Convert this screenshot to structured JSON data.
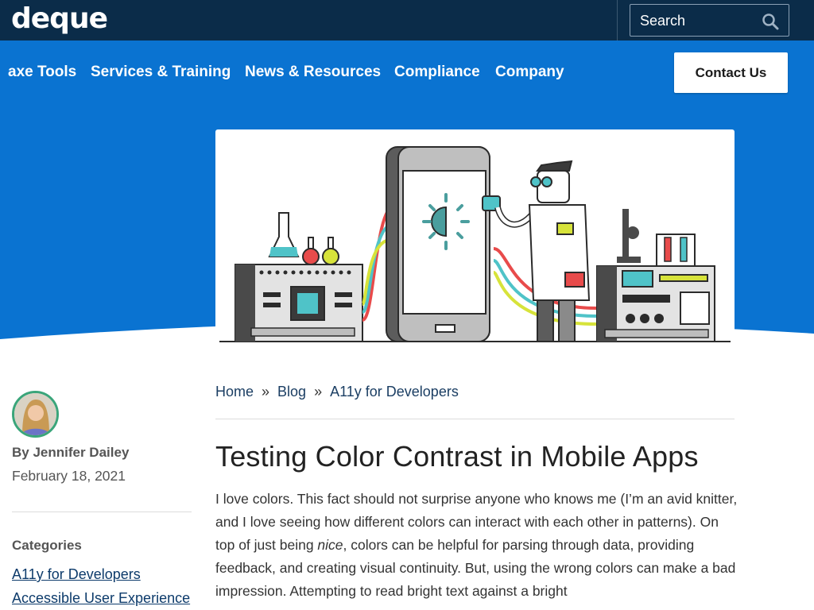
{
  "header": {
    "logo_text": "deque",
    "search_label": "Search",
    "search_icon": "magnifier-icon"
  },
  "nav": {
    "items": [
      {
        "label": "axe Tools"
      },
      {
        "label": "Services & Training"
      },
      {
        "label": "News & Resources"
      },
      {
        "label": "Compliance"
      },
      {
        "label": "Company"
      }
    ],
    "contact_label": "Contact Us"
  },
  "breadcrumb": {
    "items": [
      "Home",
      "Blog",
      "A11y for Developers"
    ],
    "separator": "»"
  },
  "article": {
    "title": "Testing Color Contrast in Mobile Apps",
    "paragraph_parts": [
      "I love colors.  This fact should not surprise anyone who knows me (I’m an avid knitter, and I love seeing how different colors can interact with each other in patterns).  On top of just being ",
      "nice",
      ", colors can be helpful for parsing through data, providing feedback, and creating visual continuity.  But, using the wrong colors can make a bad impression.  Attempting to read bright text against a bright"
    ]
  },
  "sidebar": {
    "author": "By Jennifer Dailey",
    "date": "February 18, 2021",
    "categories_heading": "Categories",
    "categories": [
      "A11y for Developers",
      "Accessible User Experience"
    ]
  },
  "colors": {
    "topbar": "#0b2c49",
    "brand_blue": "#0a73d1",
    "link": "#0d3b6b"
  }
}
